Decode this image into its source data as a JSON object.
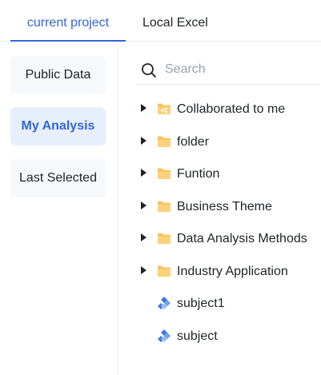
{
  "tabs": {
    "current_project": "current project",
    "local_excel": "Local Excel"
  },
  "sidebar": {
    "items": [
      {
        "label": "Public Data"
      },
      {
        "label": "My Analysis"
      },
      {
        "label": "Last Selected"
      }
    ],
    "active": "My Analysis"
  },
  "search": {
    "placeholder": "Search",
    "value": ""
  },
  "tree": {
    "items": [
      {
        "label": "Collaborated to me",
        "icon": "shared-folder-icon",
        "expandable": true
      },
      {
        "label": "folder",
        "icon": "folder-icon",
        "expandable": true
      },
      {
        "label": "Funtion",
        "icon": "folder-icon",
        "expandable": true
      },
      {
        "label": "Business Theme",
        "icon": "folder-icon",
        "expandable": true
      },
      {
        "label": "Data Analysis Methods",
        "icon": "folder-icon",
        "expandable": true
      },
      {
        "label": "Industry Application",
        "icon": "folder-icon",
        "expandable": true
      },
      {
        "label": "subject1",
        "icon": "subject-icon",
        "expandable": false
      },
      {
        "label": "subject",
        "icon": "subject-icon",
        "expandable": false
      }
    ]
  },
  "colors": {
    "accent": "#3166d6",
    "folder": "#f7c15c",
    "subject": "#3f7ae0"
  }
}
